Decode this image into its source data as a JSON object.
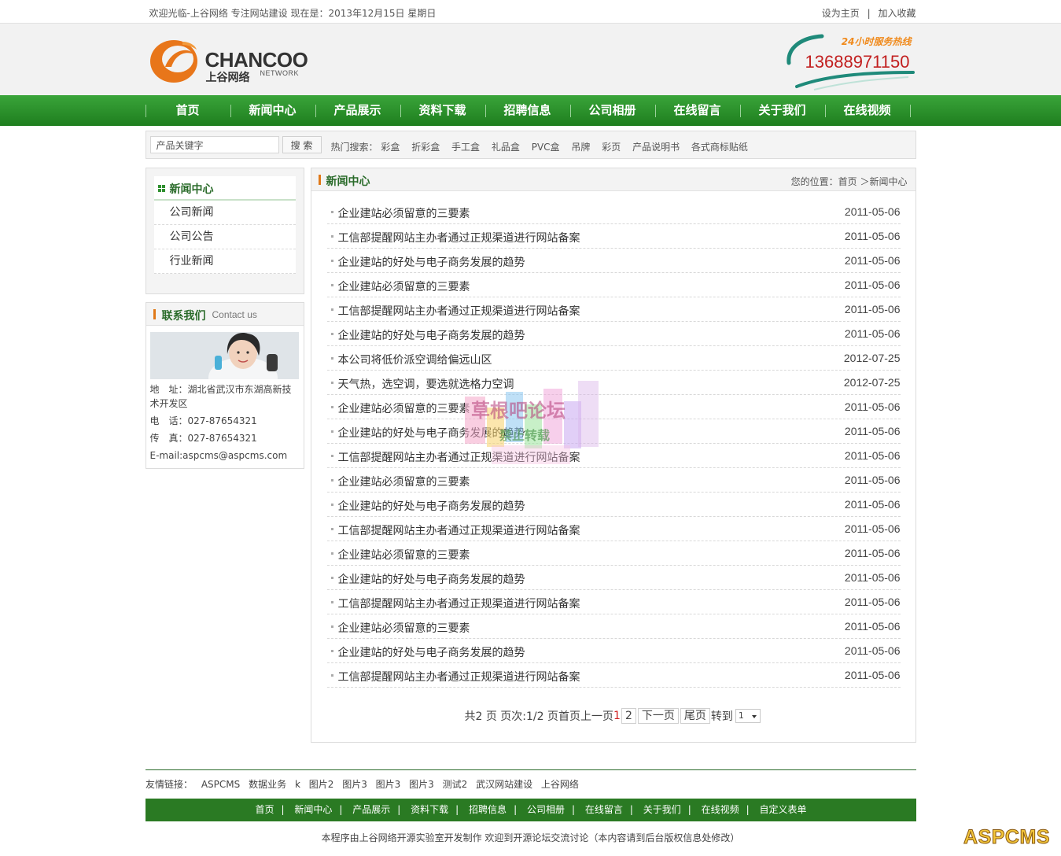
{
  "topbar": {
    "welcome": "欢迎光临-上谷网络 专注网站建设 现在是：2013年12月15日 星期日",
    "set_home": "设为主页",
    "divider": "|",
    "add_favorite": "加入收藏"
  },
  "header": {
    "logo_en": "CHANCOO",
    "logo_cn": "上谷网络",
    "logo_network": "NETWORK",
    "hotline_label": "24小时服务热线",
    "hotline_phone": "13688971150"
  },
  "nav": {
    "items": [
      "首页",
      "新闻中心",
      "产品展示",
      "资料下载",
      "招聘信息",
      "公司相册",
      "在线留言",
      "关于我们",
      "在线视频"
    ]
  },
  "search": {
    "placeholder": "产品关键字",
    "button": "搜 索",
    "hot_label": "热门搜索：",
    "hot_keywords": [
      "彩盒",
      "折彩盒",
      "手工盒",
      "礼品盒",
      "PVC盒",
      "吊牌",
      "彩页",
      "产品说明书",
      "各式商标贴纸"
    ]
  },
  "sidebar": {
    "news_title": "新闻中心",
    "news_items": [
      "公司新闻",
      "公司公告",
      "行业新闻"
    ],
    "contact_title": "联系我们",
    "contact_en": "Contact us",
    "address": "地　址：湖北省武汉市东湖高新技术开发区",
    "phone": "电　话：027-87654321",
    "fax": "传　真：027-87654321",
    "email": "E-mail:aspcms@aspcms.com"
  },
  "content": {
    "title": "新闻中心",
    "breadcrumb": "您的位置：首页 ＞新闻中心",
    "articles": [
      {
        "title": "企业建站必须留意的三要素",
        "date": "2011-05-06"
      },
      {
        "title": "工信部提醒网站主办者通过正规渠道进行网站备案",
        "date": "2011-05-06"
      },
      {
        "title": "企业建站的好处与电子商务发展的趋势",
        "date": "2011-05-06"
      },
      {
        "title": "企业建站必须留意的三要素",
        "date": "2011-05-06"
      },
      {
        "title": "工信部提醒网站主办者通过正规渠道进行网站备案",
        "date": "2011-05-06"
      },
      {
        "title": "企业建站的好处与电子商务发展的趋势",
        "date": "2011-05-06"
      },
      {
        "title": "本公司将低价派空调给偏远山区",
        "date": "2012-07-25"
      },
      {
        "title": "天气热，选空调，要选就选格力空调",
        "date": "2012-07-25"
      },
      {
        "title": "企业建站必须留意的三要素",
        "date": "2011-05-06"
      },
      {
        "title": "企业建站的好处与电子商务发展的趋势",
        "date": "2011-05-06"
      },
      {
        "title": "工信部提醒网站主办者通过正规渠道进行网站备案",
        "date": "2011-05-06"
      },
      {
        "title": "企业建站必须留意的三要素",
        "date": "2011-05-06"
      },
      {
        "title": "企业建站的好处与电子商务发展的趋势",
        "date": "2011-05-06"
      },
      {
        "title": "工信部提醒网站主办者通过正规渠道进行网站备案",
        "date": "2011-05-06"
      },
      {
        "title": "企业建站必须留意的三要素",
        "date": "2011-05-06"
      },
      {
        "title": "企业建站的好处与电子商务发展的趋势",
        "date": "2011-05-06"
      },
      {
        "title": "工信部提醒网站主办者通过正规渠道进行网站备案",
        "date": "2011-05-06"
      },
      {
        "title": "企业建站必须留意的三要素",
        "date": "2011-05-06"
      },
      {
        "title": "企业建站的好处与电子商务发展的趋势",
        "date": "2011-05-06"
      },
      {
        "title": "工信部提醒网站主办者通过正规渠道进行网站备案",
        "date": "2011-05-06"
      }
    ],
    "pager": {
      "summary": "共2 页 页次:1/2 页首页上一页",
      "current": "1",
      "page2": "2",
      "next": "下一页",
      "last": "尾页",
      "goto": "转到",
      "select_value": "1"
    }
  },
  "footer": {
    "links_label": "友情链接：",
    "links": [
      "ASPCMS",
      "数据业务",
      "k",
      "图片2",
      "图片3",
      "图片3",
      "图片3",
      "测试2",
      "武汉网站建设",
      "上谷网络"
    ],
    "nav": [
      "首页",
      "新闻中心",
      "产品展示",
      "资料下载",
      "招聘信息",
      "公司相册",
      "在线留言",
      "关于我们",
      "在线视频",
      "自定义表单"
    ],
    "nav_sep": "|",
    "copyright": "本程序由上谷网络开源实验室开发制作 欢迎到开源论坛交流讨论（本内容请到后台版权信息处修改）",
    "badge": "ASPCMS"
  },
  "watermark": {
    "line1": "草根吧论坛",
    "line2": "禁止转载"
  },
  "colors": {
    "brand_green": "#2a7a23",
    "accent_orange": "#e07818",
    "phone_red": "#c22020"
  }
}
